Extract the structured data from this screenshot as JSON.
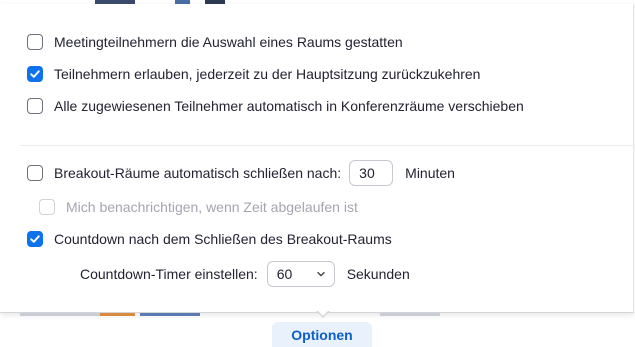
{
  "options": {
    "allow_choose_room": {
      "label": "Meetingteilnehmern die Auswahl eines Raums gestatten",
      "checked": false
    },
    "allow_return": {
      "label": "Teilnehmern erlauben, jederzeit zu der Hauptsitzung zurückzukehren",
      "checked": true
    },
    "auto_move": {
      "label": "Alle zugewiesenen Teilnehmer automatisch in Konferenzräume verschieben",
      "checked": false
    },
    "auto_close": {
      "label": "Breakout-Räume automatisch schließen nach:",
      "checked": false,
      "value": "30",
      "unit": "Minuten"
    },
    "notify_time_up": {
      "label": "Mich benachrichtigen, wenn Zeit abgelaufen ist",
      "checked": false,
      "disabled": true
    },
    "countdown": {
      "label": "Countdown nach dem Schließen des Breakout-Raums",
      "checked": true
    },
    "countdown_timer": {
      "label": "Countdown-Timer einstellen:",
      "selected": "60",
      "unit": "Sekunden"
    }
  },
  "footer_tab": {
    "label": "Optionen"
  },
  "colors": {
    "accent": "#0e72ed",
    "tab_bg": "#e8f1fc",
    "tab_text": "#0e5fc9",
    "disabled_text": "#a5a5b0",
    "text": "#232333"
  },
  "icons": {
    "check": "checkmark-icon",
    "dropdown": "chevron-down-icon"
  }
}
